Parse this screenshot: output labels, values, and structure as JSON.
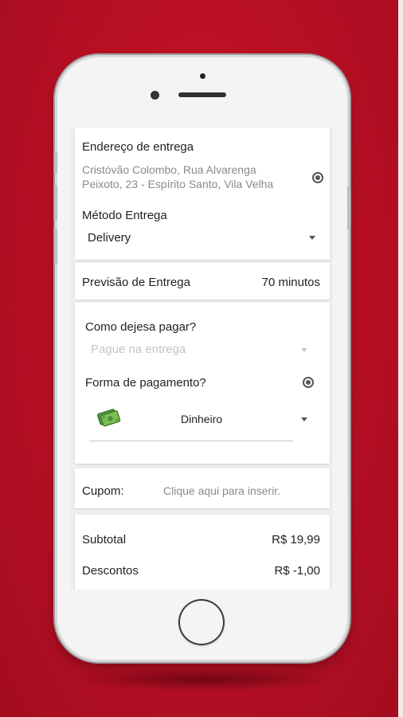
{
  "address": {
    "title": "Endereço de entrega",
    "line1": "Cristóvão Colombo, Rua Alvarenga",
    "line2": "Peixoto, 23 - Espírito Santo, Vila Velha",
    "icon": "radio-icon"
  },
  "delivery_method": {
    "title": "Método Entrega",
    "selected": "Delivery"
  },
  "eta": {
    "label": "Previsão de Entrega",
    "value": "70 minutos"
  },
  "payment": {
    "question": "Como dejesa pagar?",
    "when_placeholder": "Pague na entrega",
    "form_label": "Forma de pagamento?",
    "method": "Dinheiro",
    "method_icon": "cash-icon"
  },
  "coupon": {
    "label": "Cupom:",
    "placeholder": "Clique aqui para inserir."
  },
  "totals": {
    "subtotal_label": "Subtotal",
    "subtotal_value": "R$ 19,99",
    "discount_label": "Descontos",
    "discount_value": "R$ -1,00"
  },
  "colors": {
    "background": "#b50f24",
    "card": "#ffffff",
    "text_dark": "#222222",
    "text_grey": "#8a8a8a"
  }
}
